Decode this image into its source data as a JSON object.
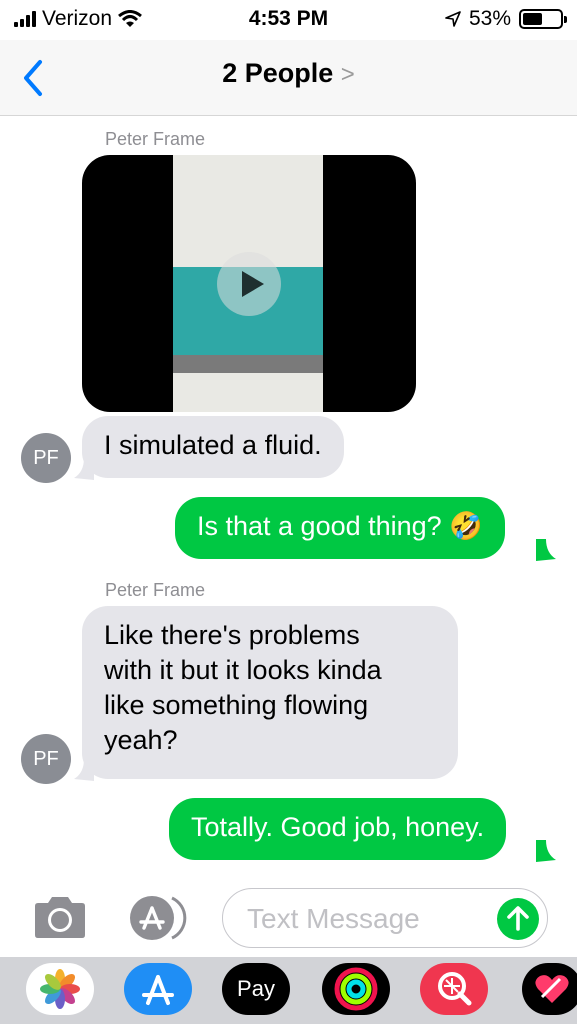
{
  "status": {
    "carrier": "Verizon",
    "time": "4:53 PM",
    "battery": "53%",
    "battery_level": 0.53
  },
  "nav": {
    "title": "2 People",
    "chevron": ">"
  },
  "messages": [
    {
      "sender": "Peter Frame"
    },
    {
      "text": "I simulated a fluid.",
      "avatar": "PF"
    },
    {
      "text": "Is that a good thing? 🤣"
    },
    {
      "sender": "Peter Frame"
    },
    {
      "lines": [
        "Like there's problems",
        "with it but it looks kinda",
        "like something flowing",
        "yeah?"
      ],
      "avatar": "PF"
    },
    {
      "text": "Totally. Good job, honey."
    }
  ],
  "input": {
    "placeholder": "Text Message"
  },
  "apps": [
    "photos",
    "app-store",
    "apple-pay",
    "activity",
    "search-images",
    "digital-touch"
  ],
  "apple_pay_label": "Pay",
  "colors": {
    "accent": "#007aff",
    "sent_bubble": "#00c843",
    "received_bubble": "#e5e5ea"
  }
}
